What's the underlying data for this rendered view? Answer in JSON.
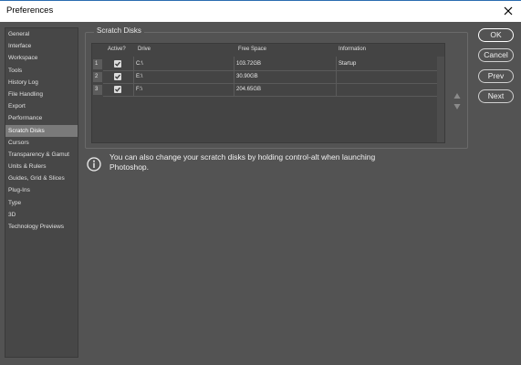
{
  "window": {
    "title": "Preferences"
  },
  "sidebar": {
    "items": [
      {
        "label": "General"
      },
      {
        "label": "Interface"
      },
      {
        "label": "Workspace"
      },
      {
        "label": "Tools"
      },
      {
        "label": "History Log"
      },
      {
        "label": "File Handling"
      },
      {
        "label": "Export"
      },
      {
        "label": "Performance"
      },
      {
        "label": "Scratch Disks",
        "active": true
      },
      {
        "label": "Cursors"
      },
      {
        "label": "Transparency & Gamut"
      },
      {
        "label": "Units & Rulers"
      },
      {
        "label": "Guides, Grid & Slices"
      },
      {
        "label": "Plug-Ins"
      },
      {
        "label": "Type"
      },
      {
        "label": "3D"
      },
      {
        "label": "Technology Previews"
      }
    ]
  },
  "scratch": {
    "group_title": "Scratch Disks",
    "columns": {
      "active": "Active?",
      "drive": "Drive",
      "free_space": "Free Space",
      "information": "Information"
    },
    "rows": [
      {
        "num": "1",
        "active": true,
        "drive": "C:\\",
        "free_space": "103.72GB",
        "information": "Startup"
      },
      {
        "num": "2",
        "active": true,
        "drive": "E:\\",
        "free_space": "30.90GB",
        "information": ""
      },
      {
        "num": "3",
        "active": true,
        "drive": "F:\\",
        "free_space": "204.65GB",
        "information": ""
      }
    ]
  },
  "info": {
    "text": "You can also change your scratch disks by holding control-alt when launching Photoshop."
  },
  "buttons": {
    "ok": "OK",
    "cancel": "Cancel",
    "prev": "Prev",
    "next": "Next"
  },
  "colors": {
    "background": "#535353",
    "panel": "#474747",
    "active_item": "#7a7a7a"
  }
}
